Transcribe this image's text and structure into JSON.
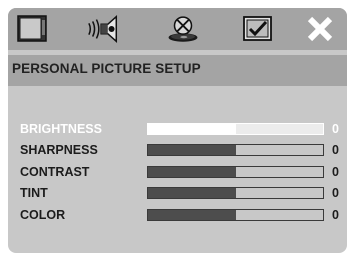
{
  "menu_icons": [
    {
      "name": "tv-screen-icon",
      "active": false
    },
    {
      "name": "speaker-sound-icon",
      "active": false
    },
    {
      "name": "disc-preference-icon",
      "active": true
    },
    {
      "name": "setup-check-icon",
      "active": false
    },
    {
      "name": "exit-x-icon",
      "active": false
    }
  ],
  "page": {
    "title": "PERSONAL PICTURE SETUP"
  },
  "settings": [
    {
      "label": "BRIGHTNESS",
      "value": "0",
      "level": 0.5,
      "selected": true
    },
    {
      "label": "SHARPNESS",
      "value": "0",
      "level": 0.5,
      "selected": false
    },
    {
      "label": "CONTRAST",
      "value": "0",
      "level": 0.5,
      "selected": false
    },
    {
      "label": "TINT",
      "value": "0",
      "level": 0.5,
      "selected": false
    },
    {
      "label": "COLOR",
      "value": "0",
      "level": 0.5,
      "selected": false
    }
  ],
  "colors": {
    "panel": "#c8c8c8",
    "bar": "#a4a4a4",
    "highlight": "#ffffff",
    "fill": "#4d4d4d"
  }
}
